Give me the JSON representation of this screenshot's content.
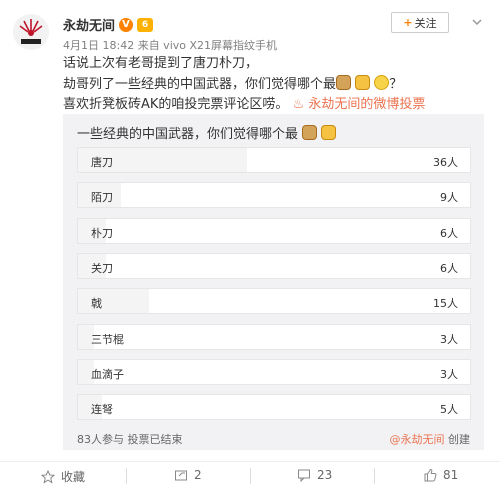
{
  "header": {
    "username": "永劫无间",
    "verified_badge": "V",
    "level_badge": "6",
    "meta": "4月1日 18:42 来自 vivo X21屏幕指纹手机",
    "follow_label": "关注",
    "follow_icon": "+",
    "menu_icon": "chevron-down-icon"
  },
  "post": {
    "line1": "话说上次有老哥提到了唐刀朴刀，",
    "line2_text": "劫哥列了一些经典的中国武器，你们觉得哪个最",
    "line2_end": "？",
    "line3_text": "喜欢折凳板砖AK的咱投完票评论区唠。",
    "line3_link": "永劫无间的微博投票"
  },
  "poll": {
    "title": "一些经典的中国武器，你们觉得哪个最",
    "options": [
      {
        "label": "唐刀",
        "count": "36人",
        "share": 0.43
      },
      {
        "label": "陌刀",
        "count": "9人",
        "share": 0.11
      },
      {
        "label": "朴刀",
        "count": "6人",
        "share": 0.07
      },
      {
        "label": "关刀",
        "count": "6人",
        "share": 0.07
      },
      {
        "label": "戟",
        "count": "15人",
        "share": 0.18
      },
      {
        "label": "三节棍",
        "count": "3人",
        "share": 0.04
      },
      {
        "label": "血滴子",
        "count": "3人",
        "share": 0.04
      },
      {
        "label": "连弩",
        "count": "5人",
        "share": 0.06
      }
    ],
    "footer": "83人参与 投票已结束",
    "creator_link": "@永劫无间",
    "creator_suffix": " 创建"
  },
  "actions": {
    "favorite_label": "收藏",
    "repost_count": "2",
    "comment_count": "23",
    "like_count": "81"
  },
  "colors": {
    "accent": "#eb7350",
    "verified": "#ff8200"
  }
}
